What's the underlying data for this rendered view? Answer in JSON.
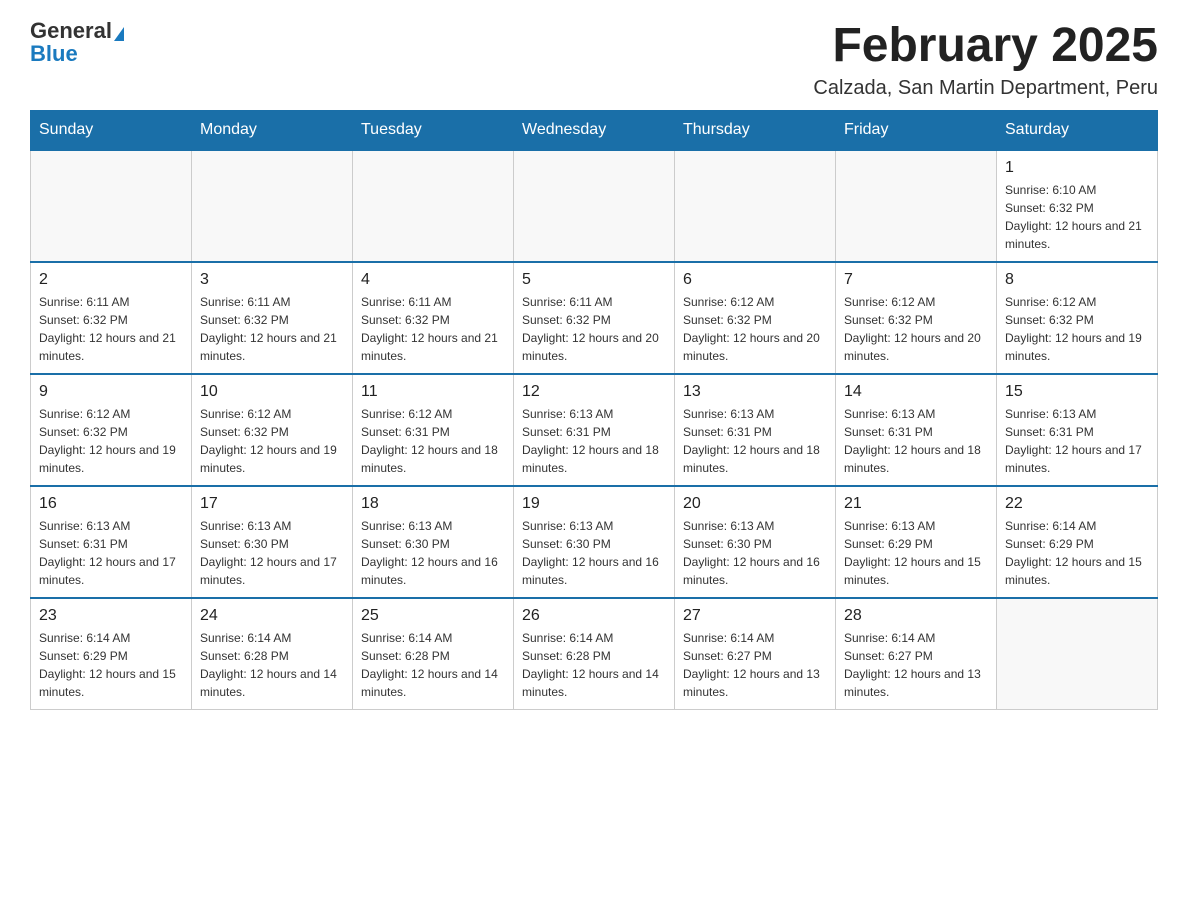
{
  "header": {
    "logo_general": "General",
    "logo_blue": "Blue",
    "month_title": "February 2025",
    "location": "Calzada, San Martin Department, Peru"
  },
  "days_of_week": [
    "Sunday",
    "Monday",
    "Tuesday",
    "Wednesday",
    "Thursday",
    "Friday",
    "Saturday"
  ],
  "weeks": [
    [
      {
        "day": "",
        "info": ""
      },
      {
        "day": "",
        "info": ""
      },
      {
        "day": "",
        "info": ""
      },
      {
        "day": "",
        "info": ""
      },
      {
        "day": "",
        "info": ""
      },
      {
        "day": "",
        "info": ""
      },
      {
        "day": "1",
        "info": "Sunrise: 6:10 AM\nSunset: 6:32 PM\nDaylight: 12 hours and 21 minutes."
      }
    ],
    [
      {
        "day": "2",
        "info": "Sunrise: 6:11 AM\nSunset: 6:32 PM\nDaylight: 12 hours and 21 minutes."
      },
      {
        "day": "3",
        "info": "Sunrise: 6:11 AM\nSunset: 6:32 PM\nDaylight: 12 hours and 21 minutes."
      },
      {
        "day": "4",
        "info": "Sunrise: 6:11 AM\nSunset: 6:32 PM\nDaylight: 12 hours and 21 minutes."
      },
      {
        "day": "5",
        "info": "Sunrise: 6:11 AM\nSunset: 6:32 PM\nDaylight: 12 hours and 20 minutes."
      },
      {
        "day": "6",
        "info": "Sunrise: 6:12 AM\nSunset: 6:32 PM\nDaylight: 12 hours and 20 minutes."
      },
      {
        "day": "7",
        "info": "Sunrise: 6:12 AM\nSunset: 6:32 PM\nDaylight: 12 hours and 20 minutes."
      },
      {
        "day": "8",
        "info": "Sunrise: 6:12 AM\nSunset: 6:32 PM\nDaylight: 12 hours and 19 minutes."
      }
    ],
    [
      {
        "day": "9",
        "info": "Sunrise: 6:12 AM\nSunset: 6:32 PM\nDaylight: 12 hours and 19 minutes."
      },
      {
        "day": "10",
        "info": "Sunrise: 6:12 AM\nSunset: 6:32 PM\nDaylight: 12 hours and 19 minutes."
      },
      {
        "day": "11",
        "info": "Sunrise: 6:12 AM\nSunset: 6:31 PM\nDaylight: 12 hours and 18 minutes."
      },
      {
        "day": "12",
        "info": "Sunrise: 6:13 AM\nSunset: 6:31 PM\nDaylight: 12 hours and 18 minutes."
      },
      {
        "day": "13",
        "info": "Sunrise: 6:13 AM\nSunset: 6:31 PM\nDaylight: 12 hours and 18 minutes."
      },
      {
        "day": "14",
        "info": "Sunrise: 6:13 AM\nSunset: 6:31 PM\nDaylight: 12 hours and 18 minutes."
      },
      {
        "day": "15",
        "info": "Sunrise: 6:13 AM\nSunset: 6:31 PM\nDaylight: 12 hours and 17 minutes."
      }
    ],
    [
      {
        "day": "16",
        "info": "Sunrise: 6:13 AM\nSunset: 6:31 PM\nDaylight: 12 hours and 17 minutes."
      },
      {
        "day": "17",
        "info": "Sunrise: 6:13 AM\nSunset: 6:30 PM\nDaylight: 12 hours and 17 minutes."
      },
      {
        "day": "18",
        "info": "Sunrise: 6:13 AM\nSunset: 6:30 PM\nDaylight: 12 hours and 16 minutes."
      },
      {
        "day": "19",
        "info": "Sunrise: 6:13 AM\nSunset: 6:30 PM\nDaylight: 12 hours and 16 minutes."
      },
      {
        "day": "20",
        "info": "Sunrise: 6:13 AM\nSunset: 6:30 PM\nDaylight: 12 hours and 16 minutes."
      },
      {
        "day": "21",
        "info": "Sunrise: 6:13 AM\nSunset: 6:29 PM\nDaylight: 12 hours and 15 minutes."
      },
      {
        "day": "22",
        "info": "Sunrise: 6:14 AM\nSunset: 6:29 PM\nDaylight: 12 hours and 15 minutes."
      }
    ],
    [
      {
        "day": "23",
        "info": "Sunrise: 6:14 AM\nSunset: 6:29 PM\nDaylight: 12 hours and 15 minutes."
      },
      {
        "day": "24",
        "info": "Sunrise: 6:14 AM\nSunset: 6:28 PM\nDaylight: 12 hours and 14 minutes."
      },
      {
        "day": "25",
        "info": "Sunrise: 6:14 AM\nSunset: 6:28 PM\nDaylight: 12 hours and 14 minutes."
      },
      {
        "day": "26",
        "info": "Sunrise: 6:14 AM\nSunset: 6:28 PM\nDaylight: 12 hours and 14 minutes."
      },
      {
        "day": "27",
        "info": "Sunrise: 6:14 AM\nSunset: 6:27 PM\nDaylight: 12 hours and 13 minutes."
      },
      {
        "day": "28",
        "info": "Sunrise: 6:14 AM\nSunset: 6:27 PM\nDaylight: 12 hours and 13 minutes."
      },
      {
        "day": "",
        "info": ""
      }
    ]
  ]
}
